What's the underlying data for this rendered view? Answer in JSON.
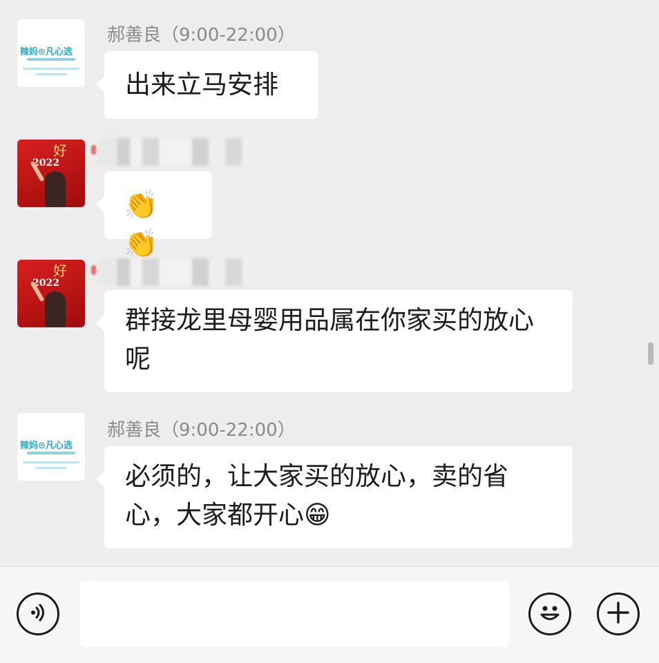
{
  "messages": [
    {
      "sender": "郝善良（9:00-22:00）",
      "avatar": "brand-logo",
      "text": "出来立马安排"
    },
    {
      "sender": "",
      "avatar": "red-2022-avatar",
      "text": "👏👏"
    },
    {
      "sender": "",
      "avatar": "red-2022-avatar",
      "text": "群接龙里母婴用品属在你家买的放心呢"
    },
    {
      "sender": "郝善良（9:00-22:00）",
      "avatar": "brand-logo",
      "text": "必须的，让大家买的放心，卖的省心，大家都开心😁"
    }
  ],
  "avatars": {
    "brand_text": "辣妈⊙凡心选",
    "red_year": "2022",
    "red_hao": "好"
  },
  "input": {
    "placeholder": "",
    "value": ""
  },
  "icons": {
    "voice": "voice-icon",
    "emoji": "emoji-icon",
    "more": "plus-icon"
  }
}
